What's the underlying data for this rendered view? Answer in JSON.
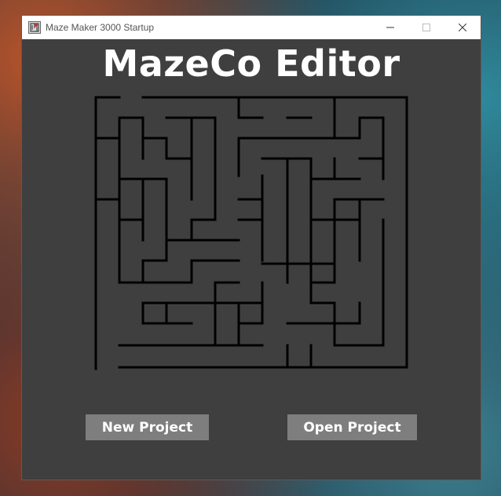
{
  "window": {
    "title": "Maze Maker 3000 Startup",
    "icon": "maze-app-icon",
    "controls": [
      "minimize-icon",
      "maximize-icon",
      "close-icon"
    ]
  },
  "app": {
    "title": "MazeCo Editor"
  },
  "buttons": {
    "new_project": "New Project",
    "open_project": "Open Project"
  },
  "colors": {
    "background": "#3f3f3f",
    "maze_wall": "#000000",
    "button": "#7e7e7e",
    "text": "#ffffff"
  }
}
